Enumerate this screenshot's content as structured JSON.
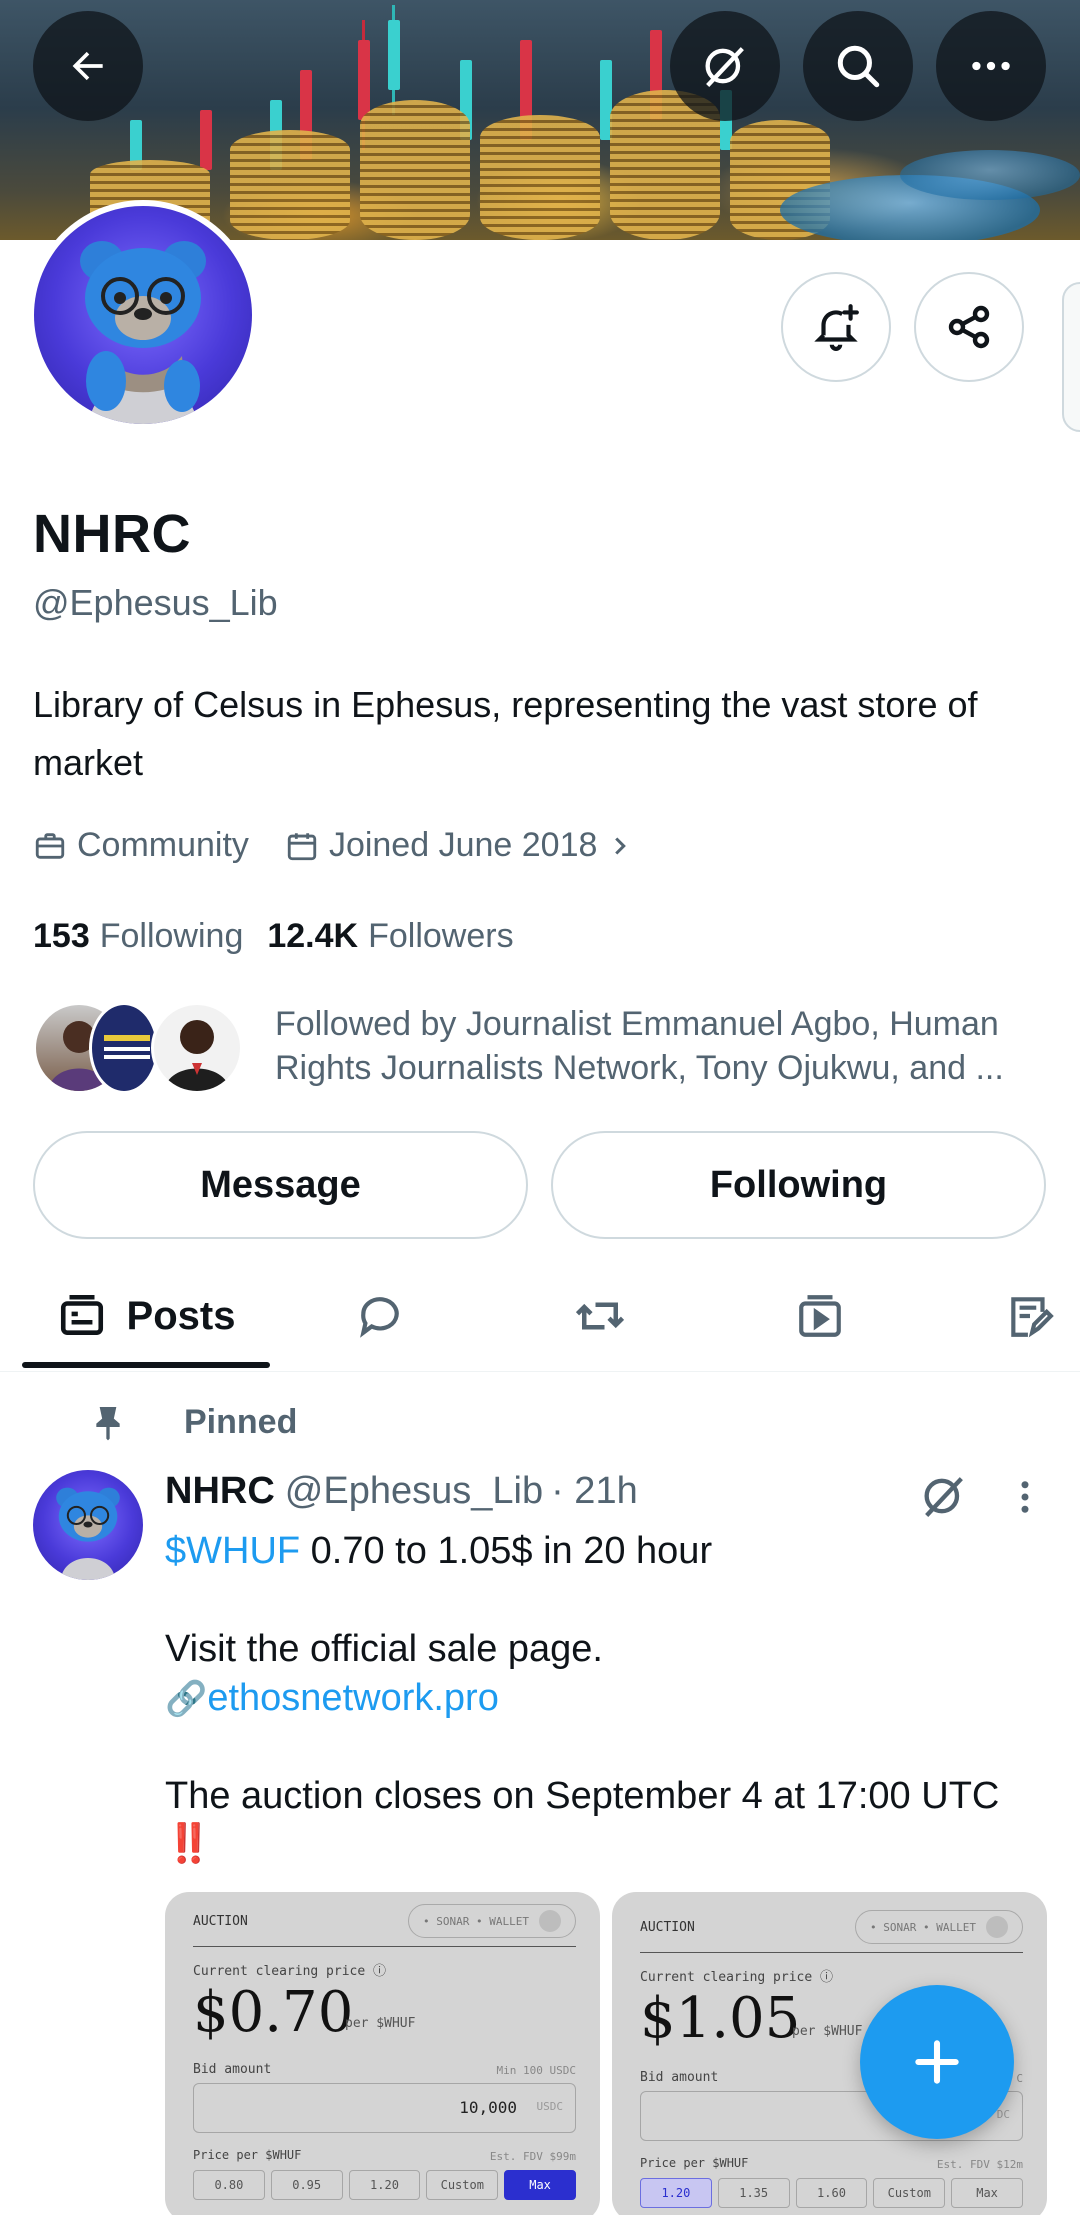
{
  "header": {
    "back_icon": "arrow-left-icon",
    "grok_icon": "grok-icon",
    "search_icon": "search-icon",
    "more_icon": "more-horizontal-icon"
  },
  "profile": {
    "display_name": "NHRC",
    "handle": "@Ephesus_Lib",
    "bio": "Library of Celsus in Ephesus, representing the vast store of market",
    "category": "Community",
    "joined": "Joined June 2018",
    "following_count": "153",
    "following_label": "Following",
    "followers_count": "12.4K",
    "followers_label": "Followers",
    "followed_by": "Followed by Journalist Emmanuel Agbo, Human Rights Journalists Network, Tony Ojukwu, and ..."
  },
  "actions": {
    "message_label": "Message",
    "following_label": "Following"
  },
  "tabs": [
    {
      "label": "Posts",
      "icon": "posts-icon",
      "active": true
    },
    {
      "label": "",
      "icon": "replies-icon"
    },
    {
      "label": "",
      "icon": "reposts-icon"
    },
    {
      "label": "",
      "icon": "media-icon"
    },
    {
      "label": "",
      "icon": "articles-icon"
    }
  ],
  "pinned_post": {
    "pinned_label": "Pinned",
    "author_name": "NHRC",
    "author_handle": "@Ephesus_Lib",
    "time": "· 21h",
    "line1_tag": "$WHUF",
    "line1_rest": " 0.70 to 1.05$ in 20 hour",
    "line2": "Visit the official sale page.",
    "link_emoji": "🔗",
    "link": "ethosnetwork.pro",
    "line3": "The auction closes on September 4 at 17:00 UTC",
    "line3_emoji": "‼️",
    "media": [
      {
        "title": "AUCTION",
        "status": "• SONAR • WALLET",
        "price_label": "Current clearing price ⓘ",
        "price": "$0.70",
        "per": "per $WHUF",
        "bid_label": "Bid amount",
        "min": "Min 100 USDC",
        "bid_value": "10,000",
        "bid_unit": "USDC",
        "price_per_label": "Price per $WHUF",
        "fdv": "Est. FDV $99m",
        "chips": [
          "0.80",
          "0.95",
          "1.20",
          "Custom",
          "Max"
        ],
        "selected_chip": 4
      },
      {
        "title": "AUCTION",
        "status": "• SONAR • WALLET",
        "price_label": "Current clearing price ⓘ",
        "price": "$1.05",
        "per": "per $WHUF",
        "bid_label": "Bid amount",
        "min": "C",
        "bid_value": "",
        "bid_unit": "DC",
        "price_per_label": "Price per $WHUF",
        "fdv": "Est. FDV $12m",
        "chips": [
          "1.20",
          "1.35",
          "1.60",
          "Custom",
          "Max"
        ],
        "selected_chip": 0
      }
    ]
  },
  "fab": {
    "icon": "plus-icon"
  }
}
